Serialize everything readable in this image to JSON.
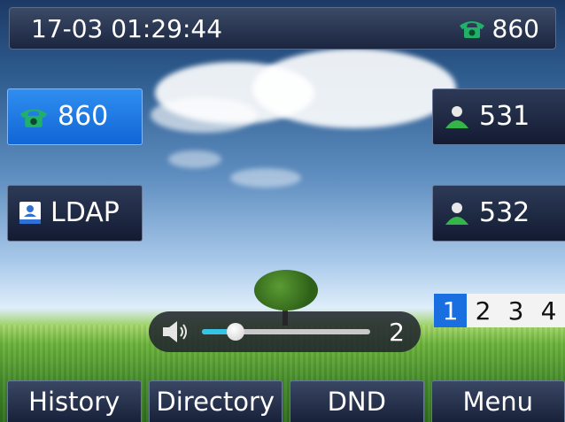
{
  "status_bar": {
    "datetime": "17-03 01:29:44",
    "account_icon": "phone-icon",
    "account": "860"
  },
  "line_keys_left": [
    {
      "label": "860",
      "icon": "phone-icon",
      "selected": true
    },
    {
      "label": "LDAP",
      "icon": "directory-book-icon",
      "selected": false
    }
  ],
  "line_keys_right": [
    {
      "label": "531",
      "icon": "contact-person-icon"
    },
    {
      "label": "532",
      "icon": "contact-person-icon"
    }
  ],
  "page_indicator": {
    "pages": [
      "1",
      "2",
      "3",
      "4"
    ],
    "active": "1"
  },
  "volume": {
    "icon": "speaker-icon",
    "level": "2",
    "level_fraction": 0.2
  },
  "softkeys": {
    "history": "History",
    "directory": "Directory",
    "dnd": "DND",
    "menu": "Menu"
  },
  "colors": {
    "selected_key": "#1a6fe0",
    "phone_icon": "#21b06a",
    "contact_icon": "#35b44a",
    "volume_fill": "#35c3e6"
  }
}
